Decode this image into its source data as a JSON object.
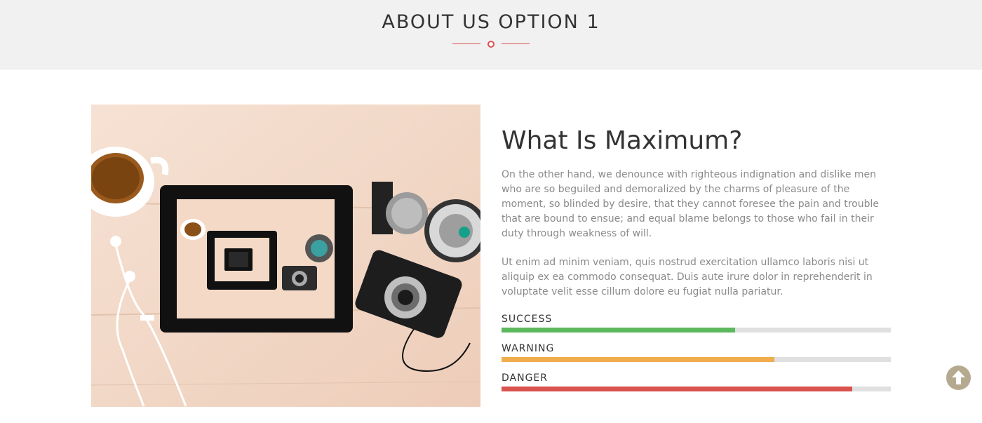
{
  "section": {
    "title": "ABOUT US OPTION 1"
  },
  "colors": {
    "accent": "#d9534f",
    "success": "#5cb85c",
    "warning": "#f0ad4e",
    "danger": "#d9534f"
  },
  "about": {
    "heading": "What Is Maximum?",
    "paragraphs": [
      "On the other hand, we denounce with righteous indignation and dislike men who are so beguiled and demoralized by the charms of pleasure of the moment, so blinded by desire, that they cannot foresee the pain and trouble that are bound to ensue; and equal blame belongs to those who fail in their duty through weakness of will.",
      "Ut enim ad minim veniam, quis nostrud exercitation ullamco laboris nisi ut aliquip ex ea commodo consequat. Duis aute irure dolor in reprehenderit in voluptate velit esse cillum dolore eu fugiat nulla pariatur."
    ]
  },
  "skills": [
    {
      "label": "SUCCESS",
      "percent": 60,
      "color": "#5cb85c"
    },
    {
      "label": "WARNING",
      "percent": 70,
      "color": "#f0ad4e"
    },
    {
      "label": "DANGER",
      "percent": 90,
      "color": "#d9534f"
    }
  ],
  "icons": {
    "scroll_top": "arrow-up-circle-icon",
    "photo": "camera-tablet-photo"
  }
}
